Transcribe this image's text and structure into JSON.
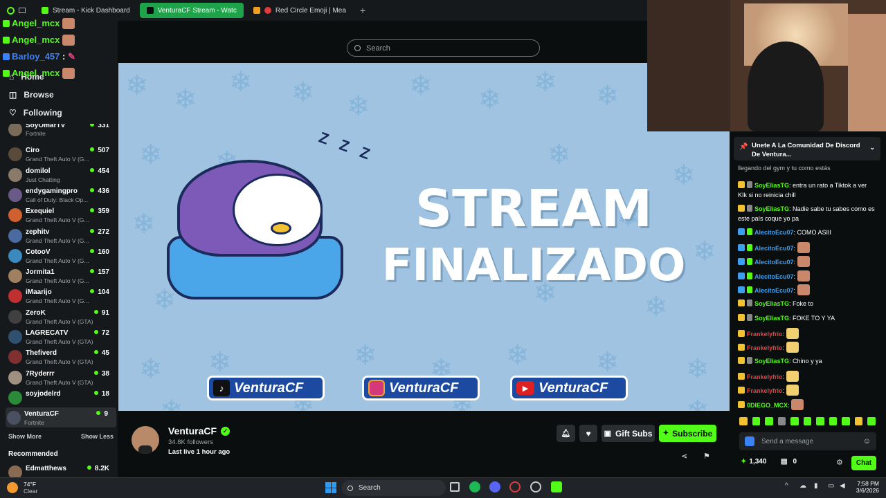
{
  "browser": {
    "tabs": [
      {
        "label": "Stream - Kick Dashboard"
      },
      {
        "label": "VenturaCF Stream - Watc"
      },
      {
        "label": "Red Circle Emoji | Mea"
      }
    ],
    "new_tab_icon": "plus-icon"
  },
  "search": {
    "placeholder": "Search"
  },
  "overlay_chat": [
    {
      "user": "Angel_mcx",
      "color": "#53fc18"
    },
    {
      "user": "Angel_mcx",
      "color": "#53fc18"
    },
    {
      "user": "Barloy_457",
      "color": "#3b82f6"
    },
    {
      "user": "Angel_mcx",
      "color": "#53fc18"
    }
  ],
  "sidebar": {
    "nav": [
      {
        "label": "Home",
        "icon": "home-icon"
      },
      {
        "label": "Browse",
        "icon": "compass-icon"
      },
      {
        "label": "Following",
        "icon": "heart-icon"
      }
    ],
    "channels": [
      {
        "name": "SoyOmarTV",
        "game": "Fortnite",
        "viewers": "331"
      },
      {
        "name": "Ciro",
        "game": "Grand Theft Auto V (G...",
        "viewers": "507"
      },
      {
        "name": "domilol",
        "game": "Just Chatting",
        "viewers": "454"
      },
      {
        "name": "endygamingpro",
        "game": "Call of Duty: Black Op...",
        "viewers": "436"
      },
      {
        "name": "Exequiel",
        "game": "Grand Theft Auto V (G...",
        "viewers": "359"
      },
      {
        "name": "zephitv",
        "game": "Grand Theft Auto V (G...",
        "viewers": "272"
      },
      {
        "name": "CotooV",
        "game": "Grand Theft Auto V (G...",
        "viewers": "160"
      },
      {
        "name": "Jormita1",
        "game": "Grand Theft Auto V (G...",
        "viewers": "157"
      },
      {
        "name": "iMaarijo",
        "game": "Grand Theft Auto V (G...",
        "viewers": "104"
      },
      {
        "name": "ZeroK",
        "game": "Grand Theft Auto V (GTA)",
        "viewers": "91"
      },
      {
        "name": "LAGRECATV",
        "game": "Grand Theft Auto V (GTA)",
        "viewers": "72"
      },
      {
        "name": "Thefiverd",
        "game": "Grand Theft Auto V (GTA)",
        "viewers": "45"
      },
      {
        "name": "7Ryderrr",
        "game": "Grand Theft Auto V (GTA)",
        "viewers": "38"
      },
      {
        "name": "soyjodelrd",
        "game": "",
        "viewers": "18"
      },
      {
        "name": "VenturaCF",
        "game": "Fortnite",
        "viewers": "9"
      }
    ],
    "show_more": "Show More",
    "show_less": "Show Less",
    "recommended_label": "Recommended",
    "recommended": [
      {
        "name": "Edmatthews",
        "viewers": "8.2K"
      }
    ]
  },
  "player": {
    "line1": "STREAM",
    "line2": "FINALIZADO",
    "zzz": "Z Z Z",
    "socials": [
      {
        "platform": "tiktok-icon",
        "handle": "VenturaCF"
      },
      {
        "platform": "instagram-icon",
        "handle": "VenturaCF"
      },
      {
        "platform": "youtube-icon",
        "handle": "VenturaCF"
      }
    ]
  },
  "channel": {
    "name": "VenturaCF",
    "followers": "34.8K followers",
    "last_live": "Last live 1 hour ago",
    "gift_subs": "Gift Subs",
    "subscribe": "Subscribe"
  },
  "chat": {
    "pinned": "Unete A La Comunidad De Discord De Ventura...",
    "partial_top": "llegando del gym y tu como estás",
    "messages": [
      {
        "user": "SoyEliasTG",
        "color": "#53fc18",
        "text": "entra un rato a Tiktok a ver KIk si no reinicia chill"
      },
      {
        "user": "SoyEliasTG",
        "color": "#53fc18",
        "text": "Nadie sabe tu sabes como es este país coque yo pa"
      },
      {
        "user": "AlecitoEcu07",
        "color": "#3b9ff0",
        "text": "COMO ASIII"
      },
      {
        "user": "AlecitoEcu07",
        "color": "#3b9ff0",
        "text": ""
      },
      {
        "user": "AlecitoEcu07",
        "color": "#3b9ff0",
        "text": ""
      },
      {
        "user": "AlecitoEcu07",
        "color": "#3b9ff0",
        "text": ""
      },
      {
        "user": "AlecitoEcu07",
        "color": "#3b9ff0",
        "text": ""
      },
      {
        "user": "SoyEliasTG",
        "color": "#53fc18",
        "text": "Foke to"
      },
      {
        "user": "SoyEliasTG",
        "color": "#53fc18",
        "text": "FOKE TO Y YA"
      },
      {
        "user": "Frankelyfrio",
        "color": "#e84040",
        "text": ""
      },
      {
        "user": "Frankelyfrio",
        "color": "#e84040",
        "text": ""
      },
      {
        "user": "SoyEliasTG",
        "color": "#53fc18",
        "text": "Chino y ya"
      },
      {
        "user": "Frankelyfrio",
        "color": "#e84040",
        "text": ""
      },
      {
        "user": "Frankelyfrio",
        "color": "#e84040",
        "text": ""
      },
      {
        "user": "0DIEGO_MCX",
        "color": "#53fc18",
        "text": ""
      }
    ],
    "input_placeholder": "Send a message",
    "points": "1,340",
    "store_count": "0",
    "chat_button": "Chat"
  },
  "taskbar": {
    "temp": "74°F",
    "weather": "Clear",
    "search": "Search",
    "time": "7:58 PM",
    "date": "3/6/2026"
  },
  "colors": {
    "accent": "#53fc18",
    "background": "#0b0e0f",
    "sidebar": "#16191b",
    "player_bg": "#9fc3e0"
  }
}
